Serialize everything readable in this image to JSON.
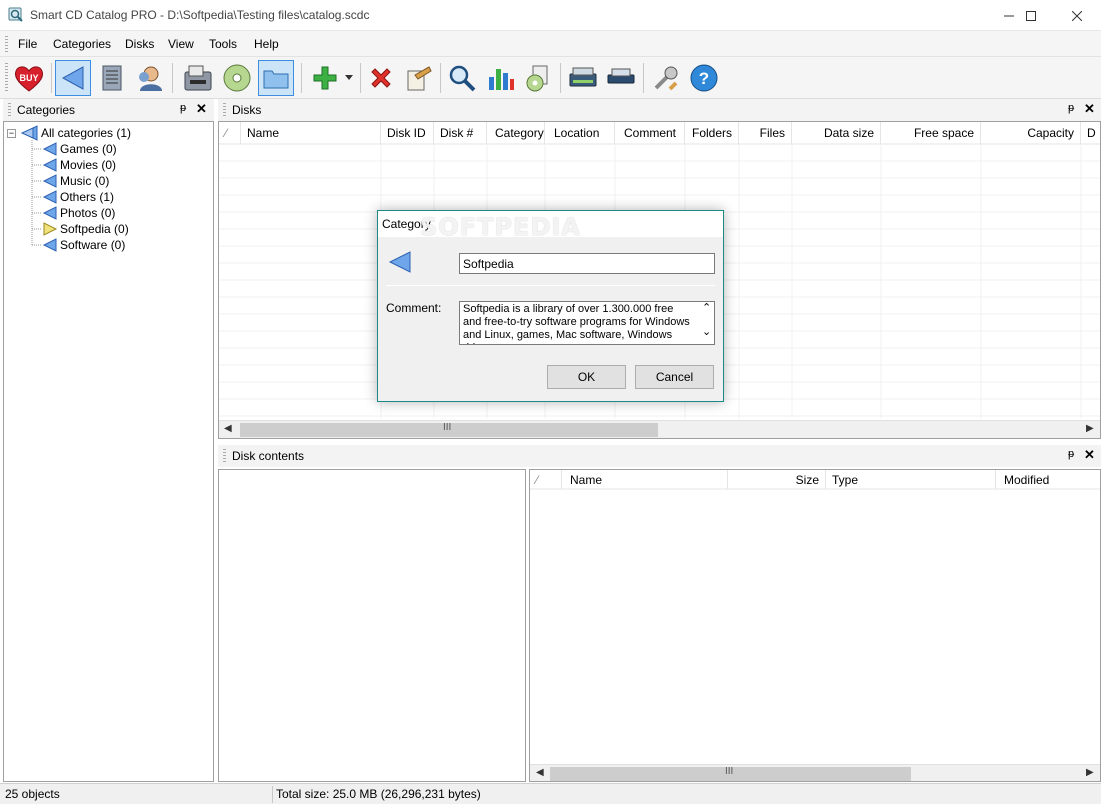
{
  "window": {
    "title": "Smart CD Catalog PRO - D:\\Softpedia\\Testing files\\catalog.scdc",
    "minimize": "—",
    "maximize": "☐",
    "close": "✕"
  },
  "menu": [
    "File",
    "Categories",
    "Disks",
    "View",
    "Tools",
    "Help"
  ],
  "toolbar": {
    "buy_label": "BUY",
    "buttons": [
      "heart-buy-icon",
      "category-icon",
      "disk-list-icon",
      "user-icon",
      "scan-disk-icon",
      "cd-icon",
      "folder-icon",
      "add-icon",
      "delete-icon",
      "properties-icon",
      "search-icon",
      "statistics-icon",
      "cd-report-icon",
      "scanner-icon",
      "printer-icon",
      "tools-icon",
      "help-icon"
    ]
  },
  "categories_panel": {
    "title": "Categories",
    "pin": "ᵽ",
    "close": "✕",
    "root": {
      "label": "All categories (1)",
      "expander": "−"
    },
    "items": [
      {
        "label": "Games (0)"
      },
      {
        "label": "Movies (0)"
      },
      {
        "label": "Music (0)"
      },
      {
        "label": "Others (1)"
      },
      {
        "label": "Photos (0)"
      },
      {
        "label": "Softpedia (0)"
      },
      {
        "label": "Software (0)"
      }
    ]
  },
  "disks_panel": {
    "title": "Disks",
    "sort_indicator": "⁄",
    "columns": [
      "Name",
      "Disk ID",
      "Disk #",
      "Category",
      "Location",
      "Comment",
      "Folders",
      "Files",
      "Data size",
      "Free space",
      "Capacity",
      "D"
    ],
    "scroll_left": "◀",
    "scroll_right": "▶",
    "scroll_grip": "III"
  },
  "contents_panel": {
    "title": "Disk contents",
    "sort_indicator": "⁄",
    "columns": [
      "Name",
      "Size",
      "Type",
      "Modified"
    ],
    "scroll_left": "◀",
    "scroll_right": "▶",
    "scroll_grip": "III"
  },
  "dialog": {
    "title": "Category",
    "name_value": "Softpedia",
    "comment_label": "Comment:",
    "comment_text": "Softpedia is a library of over 1.300.000 free and free-to-try software programs for Windows and Linux, games, Mac software, Windows drivers,",
    "scroll_up": "⌃",
    "scroll_down": "⌄",
    "ok_label": "OK",
    "cancel_label": "Cancel"
  },
  "watermark": "SOFTPEDIA",
  "status": {
    "objects": "25 objects",
    "total_size": "Total size: 25.0 MB (26,296,231 bytes)"
  },
  "colors": {
    "accent": "#3d8ee0",
    "dialog_border": "#1b8a82",
    "category_blue": "#3f7fd6",
    "category_yellow": "#f1e27a"
  }
}
